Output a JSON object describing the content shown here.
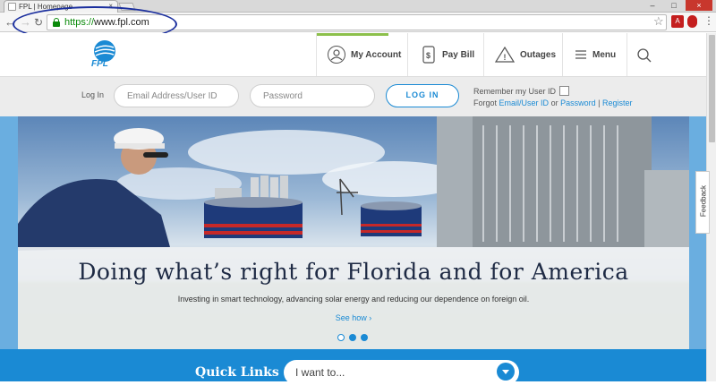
{
  "browser": {
    "tab_title": "FPL | Homepage",
    "url_scheme": "https://",
    "url_host": "www.fpl.com",
    "accent_green": "#0a8a0a"
  },
  "header": {
    "logo_text": "FPL",
    "nav": [
      {
        "label": "My Account",
        "icon": "user-icon"
      },
      {
        "label": "Pay Bill",
        "icon": "bill-icon"
      },
      {
        "label": "Outages",
        "icon": "warning-icon"
      },
      {
        "label": "Menu",
        "icon": "hamburger-icon"
      }
    ],
    "search_icon": "search-icon"
  },
  "login": {
    "label": "Log In",
    "email_placeholder": "Email Address/User ID",
    "password_placeholder": "Password",
    "button": "LOG IN",
    "remember": "Remember my User ID",
    "forgot_prefix": "Forgot",
    "forgot_user": "Email/User ID",
    "or": "or",
    "forgot_password": "Password",
    "sep": "|",
    "register": "Register"
  },
  "hero": {
    "title": "Doing what’s right for Florida and for America",
    "subtitle": "Investing in smart technology, advancing solar energy and reducing our dependence on foreign oil.",
    "link": "See how ›",
    "slides": 3,
    "active_slide": 1
  },
  "feedback": {
    "label": "Feedback"
  },
  "quick_links": {
    "label": "Quick Links",
    "select_value": "I want to..."
  },
  "colors": {
    "brand_blue": "#1a8ad4",
    "brand_green": "#8cc04b",
    "navy": "#1e2a44"
  }
}
